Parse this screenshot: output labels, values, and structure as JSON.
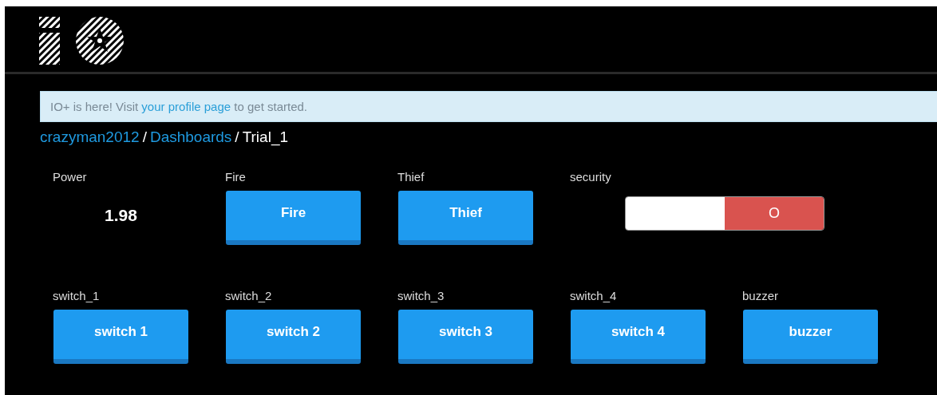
{
  "banner": {
    "before": "IO+ is here! Visit ",
    "link": "your profile page",
    "after": " to get started."
  },
  "breadcrumb": [
    {
      "label": "crazyman2012",
      "link": true
    },
    {
      "separator": "/",
      "label": "Dashboards",
      "link": true
    },
    {
      "separator": "/",
      "label": "Trial_1",
      "link": false
    }
  ],
  "blocks": [
    {
      "kind": "value",
      "title": "Power",
      "value": "1.98"
    },
    {
      "kind": "button",
      "title": "Fire",
      "label": "Fire"
    },
    {
      "kind": "button",
      "title": "Thief",
      "label": "Thief"
    },
    {
      "kind": "toggle",
      "title": "security",
      "label": "O",
      "on": false
    },
    {
      "kind": "break"
    },
    {
      "kind": "button",
      "title": "switch_1",
      "label": "switch 1"
    },
    {
      "kind": "button",
      "title": "switch_2",
      "label": "switch 2"
    },
    {
      "kind": "button",
      "title": "switch_3",
      "label": "switch 3"
    },
    {
      "kind": "button",
      "title": "switch_4",
      "label": "switch 4"
    },
    {
      "kind": "button",
      "title": "buzzer",
      "label": "buzzer"
    }
  ]
}
